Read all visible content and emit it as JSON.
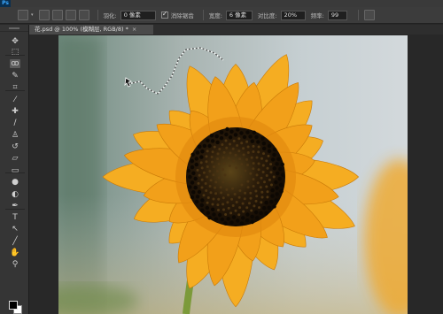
{
  "app": {
    "logo": "Ps"
  },
  "menu": [
    "",
    "",
    "",
    "",
    "",
    "",
    "",
    "",
    "",
    "",
    "",
    ""
  ],
  "options": {
    "feather_label": "羽化:",
    "feather_value": "0 像素",
    "antialias_label": "消除锯齿",
    "width_label": "宽度:",
    "width_value": "6 像素",
    "contrast_label": "对比度:",
    "contrast_value": "20%",
    "frequency_label": "频率:",
    "frequency_value": "99"
  },
  "document": {
    "tab_title": "花.psd @ 100% (模糊层, RGB/8) *",
    "close_glyph": "×"
  },
  "tools": [
    {
      "name": "move-tool",
      "glyph": "✥"
    },
    {
      "name": "marquee-tool",
      "glyph": "⬚"
    },
    {
      "name": "lasso-tool",
      "glyph": "ꝏ"
    },
    {
      "name": "quick-select-tool",
      "glyph": "✎"
    },
    {
      "name": "crop-tool",
      "glyph": "⌗"
    },
    {
      "name": "eyedropper-tool",
      "glyph": "⁄"
    },
    {
      "name": "healing-tool",
      "glyph": "✚"
    },
    {
      "name": "brush-tool",
      "glyph": "∕"
    },
    {
      "name": "stamp-tool",
      "glyph": "♙"
    },
    {
      "name": "history-brush-tool",
      "glyph": "↺"
    },
    {
      "name": "eraser-tool",
      "glyph": "▱"
    },
    {
      "name": "gradient-tool",
      "glyph": "▭"
    },
    {
      "name": "blur-tool",
      "glyph": "●"
    },
    {
      "name": "dodge-tool",
      "glyph": "◐"
    },
    {
      "name": "pen-tool",
      "glyph": "✒"
    },
    {
      "name": "type-tool",
      "glyph": "T"
    },
    {
      "name": "path-select-tool",
      "glyph": "↖"
    },
    {
      "name": "shape-tool",
      "glyph": "╱"
    },
    {
      "name": "hand-tool",
      "glyph": "✋"
    },
    {
      "name": "zoom-tool",
      "glyph": "⚲"
    }
  ],
  "colors": {
    "foreground": "#000000",
    "background": "#ffffff",
    "petal": "#f2a81c",
    "center": "#2a1a0a"
  }
}
